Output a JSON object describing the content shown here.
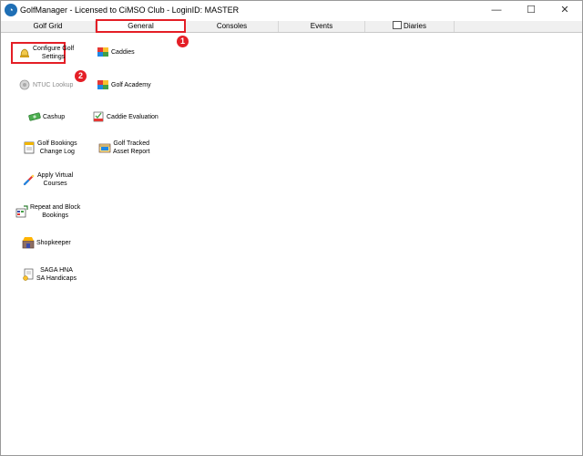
{
  "window": {
    "title": "GolfManager - Licensed to CiMSO Club - LoginID: MASTER",
    "minimize_symbol": "—",
    "maximize_symbol": "☐",
    "close_symbol": "✕"
  },
  "tabs": [
    {
      "label": "Golf Grid"
    },
    {
      "label": "General"
    },
    {
      "label": "Consoles"
    },
    {
      "label": "Events"
    },
    {
      "label": "Diaries"
    }
  ],
  "markers": {
    "one": "1",
    "two": "2"
  },
  "tiles": [
    {
      "label": "Configure Golf\nSettings",
      "icon": "settings-bell-icon"
    },
    {
      "label": "Caddies",
      "icon": "caddies-icon"
    },
    {
      "label": "NTUC Lookup",
      "icon": "lookup-icon"
    },
    {
      "label": "Golf Academy",
      "icon": "academy-icon"
    },
    {
      "label": "Cashup",
      "icon": "cash-icon"
    },
    {
      "label": "Caddie Evaluation",
      "icon": "evaluation-icon"
    },
    {
      "label": "Golf Bookings\nChange Log",
      "icon": "log-icon"
    },
    {
      "label": "Golf Tracked\nAsset Report",
      "icon": "asset-report-icon"
    },
    {
      "label": "Apply Virtual\nCourses",
      "icon": "virtual-courses-icon"
    },
    {
      "label": "Repeat and Block\nBookings",
      "icon": "repeat-bookings-icon"
    },
    {
      "label": "Shopkeeper",
      "icon": "shopkeeper-icon"
    },
    {
      "label": "SAGA HNA\nSA Handicaps",
      "icon": "handicaps-icon"
    }
  ],
  "colors": {
    "accent": "#e41e26",
    "app_blue": "#1f6fb5"
  }
}
